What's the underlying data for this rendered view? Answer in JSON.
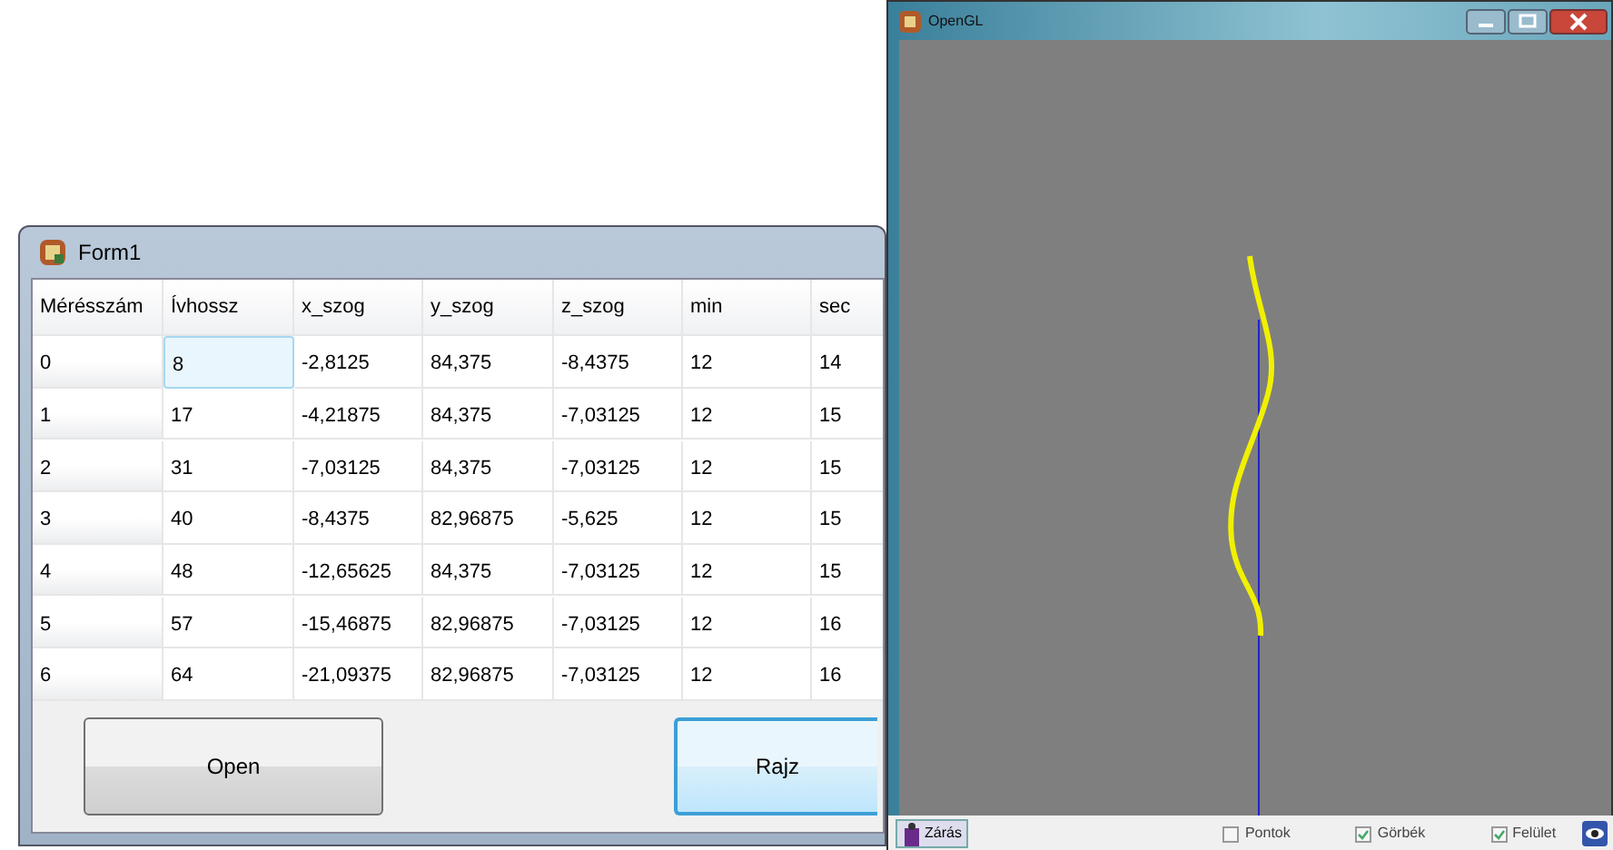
{
  "form_window": {
    "title": "Form1",
    "table": {
      "columns": [
        "Mérésszám",
        "Ívhossz",
        "x_szog",
        "y_szog",
        "z_szog",
        "min",
        "sec"
      ],
      "rows": [
        {
          "cells": [
            {
              "text": "0",
              "selected": false
            },
            {
              "text": "8",
              "selected": true
            },
            {
              "text": "-2,8125",
              "selected": false
            },
            {
              "text": "84,375",
              "selected": false
            },
            {
              "text": "-8,4375",
              "selected": false
            },
            {
              "text": "12",
              "selected": false
            },
            {
              "text": "14",
              "selected": false
            }
          ]
        },
        {
          "cells": [
            {
              "text": "1",
              "selected": false
            },
            {
              "text": "17",
              "selected": false
            },
            {
              "text": "-4,21875",
              "selected": false
            },
            {
              "text": "84,375",
              "selected": false
            },
            {
              "text": "-7,03125",
              "selected": false
            },
            {
              "text": "12",
              "selected": false
            },
            {
              "text": "15",
              "selected": false
            }
          ]
        },
        {
          "cells": [
            {
              "text": "2",
              "selected": false
            },
            {
              "text": "31",
              "selected": false
            },
            {
              "text": "-7,03125",
              "selected": false
            },
            {
              "text": "84,375",
              "selected": false
            },
            {
              "text": "-7,03125",
              "selected": false
            },
            {
              "text": "12",
              "selected": false
            },
            {
              "text": "15",
              "selected": false
            }
          ]
        },
        {
          "cells": [
            {
              "text": "3",
              "selected": false
            },
            {
              "text": "40",
              "selected": false
            },
            {
              "text": "-8,4375",
              "selected": false
            },
            {
              "text": "82,96875",
              "selected": false
            },
            {
              "text": "-5,625",
              "selected": false
            },
            {
              "text": "12",
              "selected": false
            },
            {
              "text": "15",
              "selected": false
            }
          ]
        },
        {
          "cells": [
            {
              "text": "4",
              "selected": false
            },
            {
              "text": "48",
              "selected": false
            },
            {
              "text": "-12,65625",
              "selected": false
            },
            {
              "text": "84,375",
              "selected": false
            },
            {
              "text": "-7,03125",
              "selected": false
            },
            {
              "text": "12",
              "selected": false
            },
            {
              "text": "15",
              "selected": false
            }
          ]
        },
        {
          "cells": [
            {
              "text": "5",
              "selected": false
            },
            {
              "text": "57",
              "selected": false
            },
            {
              "text": "-15,46875",
              "selected": false
            },
            {
              "text": "82,96875",
              "selected": false
            },
            {
              "text": "-7,03125",
              "selected": false
            },
            {
              "text": "12",
              "selected": false
            },
            {
              "text": "16",
              "selected": false
            }
          ]
        },
        {
          "cells": [
            {
              "text": "6",
              "selected": false
            },
            {
              "text": "64",
              "selected": false
            },
            {
              "text": "-21,09375",
              "selected": false
            },
            {
              "text": "82,96875",
              "selected": false
            },
            {
              "text": "-7,03125",
              "selected": false
            },
            {
              "text": "12",
              "selected": false
            },
            {
              "text": "16",
              "selected": false
            }
          ]
        }
      ]
    },
    "buttons": [
      {
        "label": "Open",
        "default": false
      },
      {
        "label": "Rajz",
        "default": true
      }
    ]
  },
  "gl_window": {
    "title": "OpenGL",
    "close_button": "Zárás",
    "checkboxes": [
      {
        "label": "Pontok",
        "checked": false
      },
      {
        "label": "Görbék",
        "checked": true
      },
      {
        "label": "Felület",
        "checked": true
      }
    ]
  }
}
